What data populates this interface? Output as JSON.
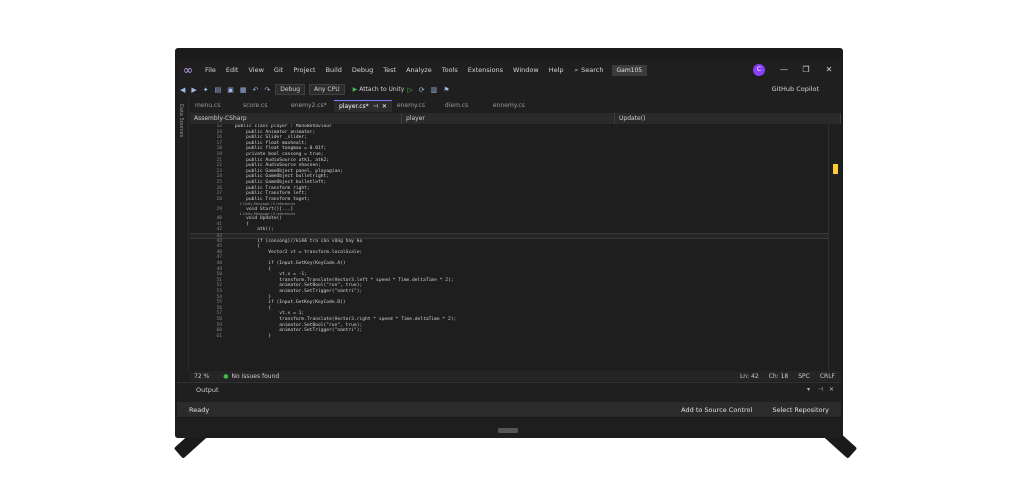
{
  "title_bar": {
    "menu": [
      "File",
      "Edit",
      "View",
      "Git",
      "Project",
      "Build",
      "Debug",
      "Test",
      "Analyze",
      "Tools",
      "Extensions",
      "Window",
      "Help"
    ],
    "search_label": "Search",
    "solution_name": "Gam105",
    "user_initial": "C",
    "win_minimize": "—",
    "win_maximize": "❐",
    "win_close": "✕"
  },
  "toolbar": {
    "config": "Debug",
    "platform": "Any CPU",
    "run_target": "Attach to Unity",
    "copilot": "GitHub Copilot"
  },
  "side_panel": {
    "label": "Data Sources"
  },
  "tabs": [
    {
      "label": "menu.cs",
      "active": false
    },
    {
      "label": "score.cs",
      "active": false
    },
    {
      "label": "enemy2.cs*",
      "active": false
    },
    {
      "label": "player.cs*",
      "active": true
    },
    {
      "label": "enemy.cs",
      "active": false
    },
    {
      "label": "diem.cs",
      "active": false
    },
    {
      "label": "ennemy.cs",
      "active": false
    }
  ],
  "nav": {
    "project": "Assembly-CSharp",
    "class": "player",
    "member": "Update()"
  },
  "code_lines": [
    {
      "n": "12",
      "t": "public class player : MonoBehaviour"
    },
    {
      "n": "14",
      "t": "    public Animator animator;"
    },
    {
      "n": "16",
      "t": "    public Slider _slider;"
    },
    {
      "n": "17",
      "t": "    public float maxhealt;"
    },
    {
      "n": "18",
      "t": "    public float tangmau = 0.01f;"
    },
    {
      "n": "19",
      "t": "    private bool consong = true;"
    },
    {
      "n": "21",
      "t": "    public AudioSource atk1, atk2;"
    },
    {
      "n": "22",
      "t": "    public AudioSource nhacnen;"
    },
    {
      "n": "23",
      "t": "    public GameObject panel, playagian;"
    },
    {
      "n": "24",
      "t": "    public GameObject bulletright;"
    },
    {
      "n": "25",
      "t": "    public GameObject bulletleft;"
    },
    {
      "n": "26",
      "t": "    public Transform right;"
    },
    {
      "n": "27",
      "t": "    public Transform left;"
    },
    {
      "n": "28",
      "t": "    public Transform taget;"
    },
    {
      "n": "",
      "t": "    1 Unity Message | 0 references",
      "ref": true
    },
    {
      "n": "29",
      "t": "    void Start()[...]"
    },
    {
      "n": "",
      "t": "    1 Unity Message | 0 references",
      "ref": true
    },
    {
      "n": "40",
      "t": "    void Update()"
    },
    {
      "n": "41",
      "t": "    {"
    },
    {
      "n": "42",
      "t": "        atk();"
    },
    {
      "n": "43",
      "t": "",
      "cur": true
    },
    {
      "n": "44",
      "t": "        if (consong)//kiểm tra còn sống hay ko"
    },
    {
      "n": "45",
      "t": "        {"
    },
    {
      "n": "46",
      "t": "            Vector2 vt = transform.localScale;"
    },
    {
      "n": "47",
      "t": ""
    },
    {
      "n": "48",
      "t": "            if (Input.GetKey(KeyCode.A))"
    },
    {
      "n": "49",
      "t": "            {"
    },
    {
      "n": "50",
      "t": "                vt.x = -1;"
    },
    {
      "n": "51",
      "t": "                transform.Translate(Vector3.left * speed * Time.deltaTime * 2);"
    },
    {
      "n": "52",
      "t": "                animator.SetBool(\"run\", true);"
    },
    {
      "n": "53",
      "t": "                animator.SetTrigger(\"nantri\");"
    },
    {
      "n": "54",
      "t": "            }"
    },
    {
      "n": "55",
      "t": "            if (Input.GetKey(KeyCode.D))"
    },
    {
      "n": "56",
      "t": "            {"
    },
    {
      "n": "57",
      "t": "                vt.x = 1;"
    },
    {
      "n": "58",
      "t": "                transform.Translate(Vector3.right * speed * Time.deltaTime * 2);"
    },
    {
      "n": "59",
      "t": "                animator.SetBool(\"run\", true);"
    },
    {
      "n": "60",
      "t": "                animator.SetTrigger(\"nantri\");"
    },
    {
      "n": "61",
      "t": "            }"
    }
  ],
  "editor_status": {
    "zoom": "72 %",
    "issues": "No issues found",
    "ln": "Ln: 42",
    "ch": "Ch: 18",
    "spc": "SPC",
    "crlf": "CRLF"
  },
  "output": {
    "title": "Output"
  },
  "status_bar": {
    "ready": "Ready",
    "source_control": "Add to Source Control",
    "repository": "Select Repository"
  },
  "colors": {
    "editor_bg": "#1e1e1e",
    "accent": "#8a3ffc",
    "run_green": "#3fb950"
  }
}
